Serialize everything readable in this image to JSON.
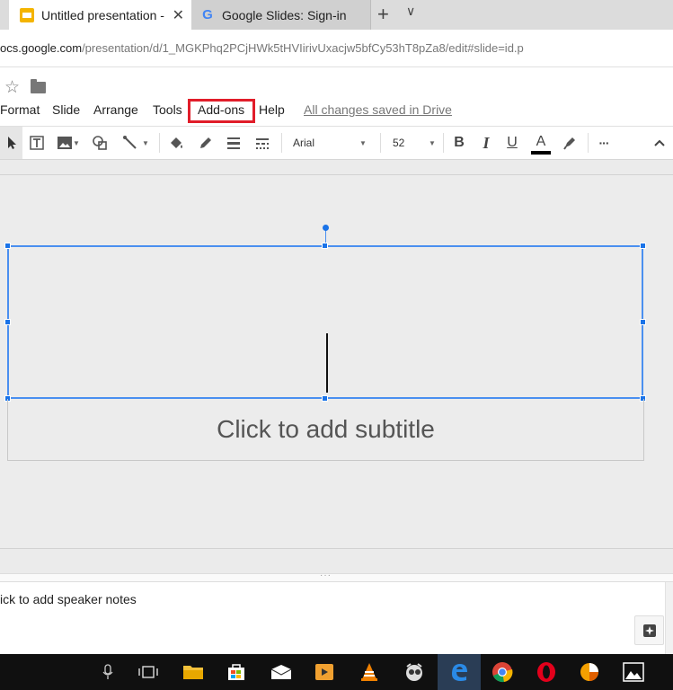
{
  "browser": {
    "tabs": [
      {
        "title": "Untitled presentation - Google Slides",
        "active": true
      },
      {
        "title": "Google Slides: Sign-in",
        "active": false
      }
    ],
    "new_tab_symbol": "+",
    "tab_list_symbol": "∨",
    "url_prefix": "ocs.google.com",
    "url_path": "/presentation/d/1_MGKPhq2PCjHWk5tHVIirivUxacjw5bfCy53hT8pZa8/edit#slide=id.p"
  },
  "menu": {
    "items": [
      "Format",
      "Slide",
      "Arrange",
      "Tools",
      "Add-ons",
      "Help"
    ],
    "highlighted": "Add-ons",
    "highlight_color": "#e11d2a",
    "saved_status": "All changes saved in Drive"
  },
  "toolbar": {
    "font_name": "Arial",
    "font_size": "52",
    "bold": "B",
    "italic": "I",
    "underline": "U",
    "text_color_letter": "A",
    "more": "···",
    "icons": [
      "select-icon",
      "textbox-icon",
      "image-icon",
      "shape-icon",
      "line-icon",
      "fill-color-icon",
      "border-color-icon",
      "border-weight-icon",
      "border-dash-icon",
      "highlight-icon",
      "collapse-icon"
    ]
  },
  "slide": {
    "subtitle_placeholder": "Click to add subtitle",
    "selection_color": "#4a8ff0"
  },
  "notes": {
    "placeholder": "ick to add speaker notes"
  },
  "taskbar": {
    "icons": [
      "microphone-icon",
      "task-view-icon",
      "file-explorer-icon",
      "store-icon",
      "mail-icon",
      "media-player-icon",
      "vlc-icon",
      "app-icon",
      "edge-icon",
      "chrome-icon",
      "opera-icon",
      "pie-chart-app-icon",
      "photos-icon"
    ]
  }
}
